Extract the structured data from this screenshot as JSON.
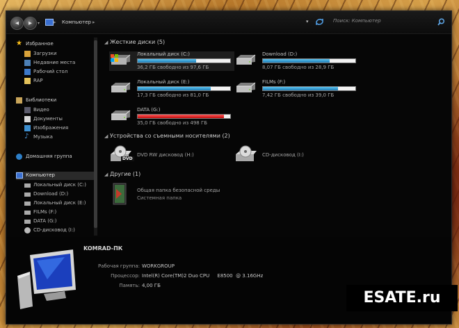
{
  "toolbar": {
    "breadcrumb": "Компьютер",
    "breadcrumb_sep": "▸",
    "search_placeholder": "Поиск: Компьютер"
  },
  "sidebar": {
    "favorites_header": "Избранное",
    "favorites": [
      "Загрузки",
      "Недавние места",
      "Рабочий стол",
      "RAP"
    ],
    "libraries_header": "Библиотеки",
    "libraries": [
      "Видео",
      "Документы",
      "Изображения",
      "Музыка"
    ],
    "homegroup": "Домашняя группа",
    "computer_header": "Компьютер",
    "computer_items": [
      "Локальный диск (C:)",
      "Download (D:)",
      "Локальный диск (E:)",
      "FILMs (F:)",
      "DATA (G:)",
      "CD-дисковод (I:)"
    ]
  },
  "sections": {
    "hdd_header": "Жесткие диски (5)",
    "removable_header": "Устройства со съемными носителями (2)",
    "other_header": "Другие (1)"
  },
  "drives": [
    {
      "name": "Локальный диск (C:)",
      "free": "36,2 ГБ свободно из 97,6 ГБ",
      "used_fraction": 0.63,
      "color": "#2b8fd0"
    },
    {
      "name": "Download (D:)",
      "free": "8,07 ГБ свободно из 28,9 ГБ",
      "used_fraction": 0.72,
      "color": "#2b8fd0"
    },
    {
      "name": "Локальный диск (E:)",
      "free": "17,3 ГБ свободно из 81,0 ГБ",
      "used_fraction": 0.79,
      "color": "#2b8fd0"
    },
    {
      "name": "FILMs (F:)",
      "free": "7,42 ГБ свободно из 39,0 ГБ",
      "used_fraction": 0.81,
      "color": "#2b8fd0"
    },
    {
      "name": "DATA (G:)",
      "free": "35,0 ГБ свободно из 498 ГБ",
      "used_fraction": 0.93,
      "color": "#d41515"
    }
  ],
  "removable": [
    {
      "name": "DVD RW дисковод (H:)",
      "badge": "DVD"
    },
    {
      "name": "CD-дисковод (I:)"
    }
  ],
  "other": {
    "name": "Общая папка безопасной среды",
    "type": "Системная папка"
  },
  "details": {
    "pc_name": "KOMRAD-ПК",
    "workgroup_label": "Рабочая группа:",
    "workgroup": "WORKGROUP",
    "cpu_label": "Процессор:",
    "cpu": "Intel(R) Core(TM)2 Duo CPU     E8500  @ 3.16GHz",
    "mem_label": "Память:",
    "mem": "4,00 ГБ"
  },
  "watermark": "ESATE.ru"
}
